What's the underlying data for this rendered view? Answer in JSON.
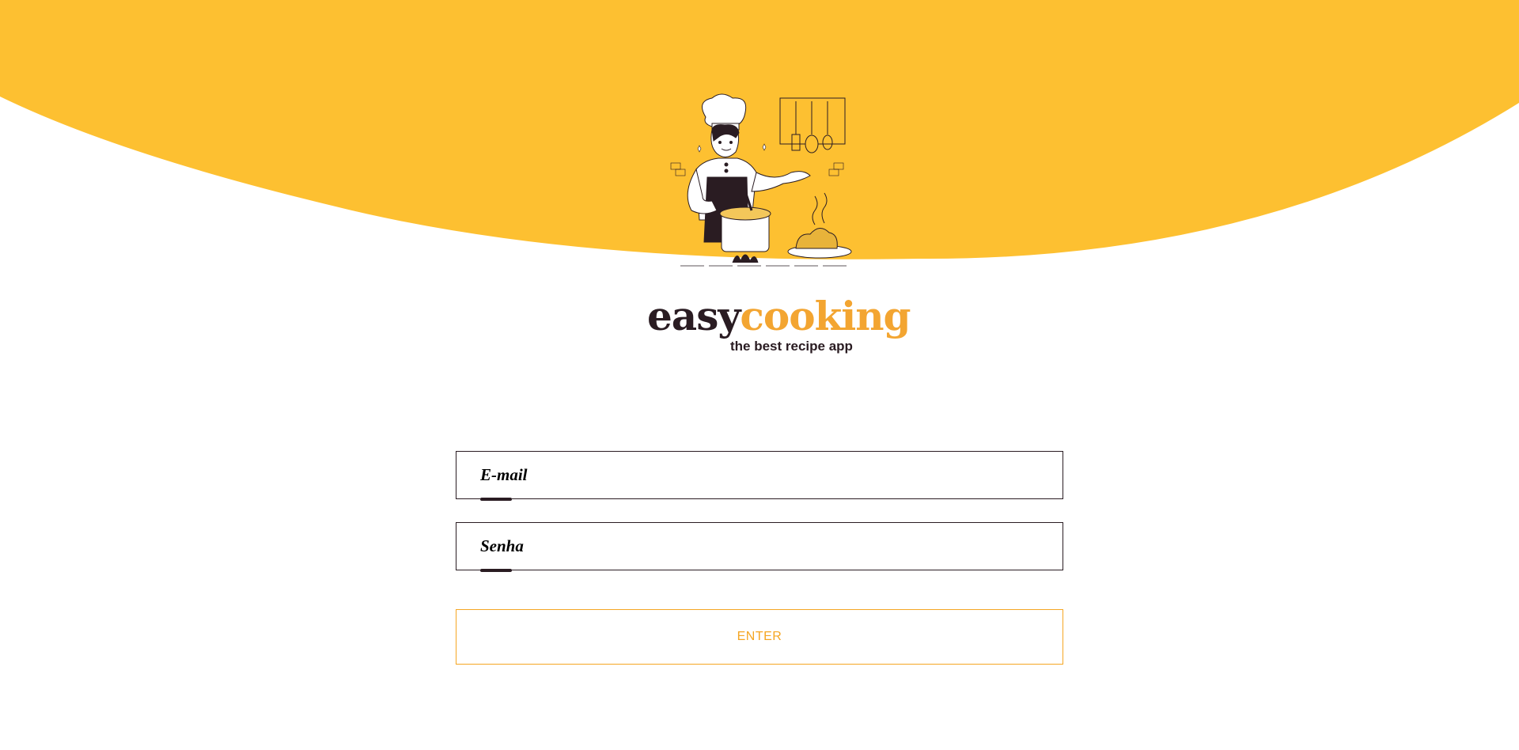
{
  "brand": {
    "name_part1": "easy",
    "name_part2": "cooking",
    "tagline": "the best recipe app"
  },
  "illustration": {
    "icon": "chef-cooking-illustration"
  },
  "login_form": {
    "email_placeholder": "E-mail",
    "password_placeholder": "Senha",
    "submit_label": "ENTER"
  },
  "colors": {
    "header_background": "#fdc031",
    "brand_dark": "#2a1c22",
    "brand_accent": "#f3a531",
    "button_border": "#f5a623"
  }
}
